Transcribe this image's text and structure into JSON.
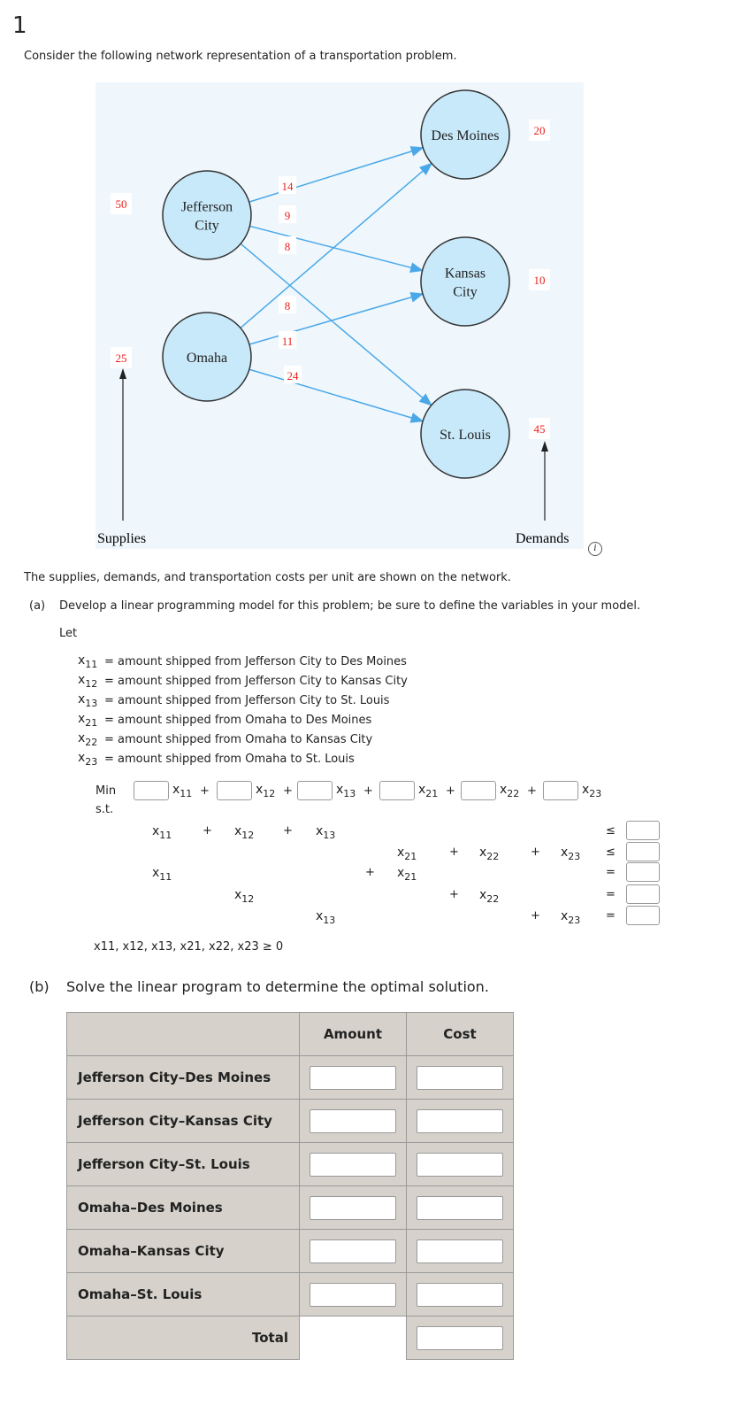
{
  "question_number": "1",
  "intro": "Consider the following network representation of a transportation problem.",
  "network": {
    "supplies_label": "Supplies",
    "demands_label": "Demands",
    "origins": [
      {
        "name_lines": [
          "Jefferson",
          "City"
        ],
        "supply": "50"
      },
      {
        "name_lines": [
          "Omaha"
        ],
        "supply": "25"
      }
    ],
    "destinations": [
      {
        "name_lines": [
          "Des Moines"
        ],
        "demand": "20"
      },
      {
        "name_lines": [
          "Kansas",
          "City"
        ],
        "demand": "10"
      },
      {
        "name_lines": [
          "St. Louis"
        ],
        "demand": "45"
      }
    ],
    "costs": {
      "jc_dm": "14",
      "jc_kc": "9",
      "jc_sl": "8",
      "om_dm": "8",
      "om_kc": "11",
      "om_sl": "24"
    },
    "colors": {
      "node_fill": "#c8e9f9",
      "arrow": "#4aa8e8",
      "cost_text": "#e8201c",
      "background": "#eff7fd"
    }
  },
  "info_icon": "info-icon",
  "network_note": "The supplies, demands, and transportation costs per unit are shown on the network.",
  "part_a": {
    "label": "(a)",
    "text": "Develop a linear programming model for this problem; be sure to define the variables in your model.",
    "let": "Let",
    "definitions": [
      {
        "var": "x",
        "sub": "11",
        "text": "= amount shipped from Jefferson City to Des Moines"
      },
      {
        "var": "x",
        "sub": "12",
        "text": "= amount shipped from Jefferson City to Kansas City"
      },
      {
        "var": "x",
        "sub": "13",
        "text": "= amount shipped from Jefferson City to St. Louis"
      },
      {
        "var": "x",
        "sub": "21",
        "text": "= amount shipped from Omaha to Des Moines"
      },
      {
        "var": "x",
        "sub": "22",
        "text": "= amount shipped from Omaha to Kansas City"
      },
      {
        "var": "x",
        "sub": "23",
        "text": "= amount shipped from Omaha to St. Louis"
      }
    ],
    "min": "Min",
    "st": "s.t.",
    "nonneg": "x11, x12, x13, x21, x22, x23 ≥ 0",
    "constraint_signs": [
      "≤",
      "≤",
      "=",
      "=",
      "="
    ]
  },
  "part_b": {
    "label": "(b)",
    "text": "Solve the linear program to determine the optimal solution.",
    "headers": [
      "",
      "Amount",
      "Cost"
    ],
    "rows": [
      "Jefferson City–Des Moines",
      "Jefferson City–Kansas City",
      "Jefferson City–St. Louis",
      "Omaha–Des Moines",
      "Omaha–Kansas City",
      "Omaha–St. Louis"
    ],
    "total": "Total"
  }
}
